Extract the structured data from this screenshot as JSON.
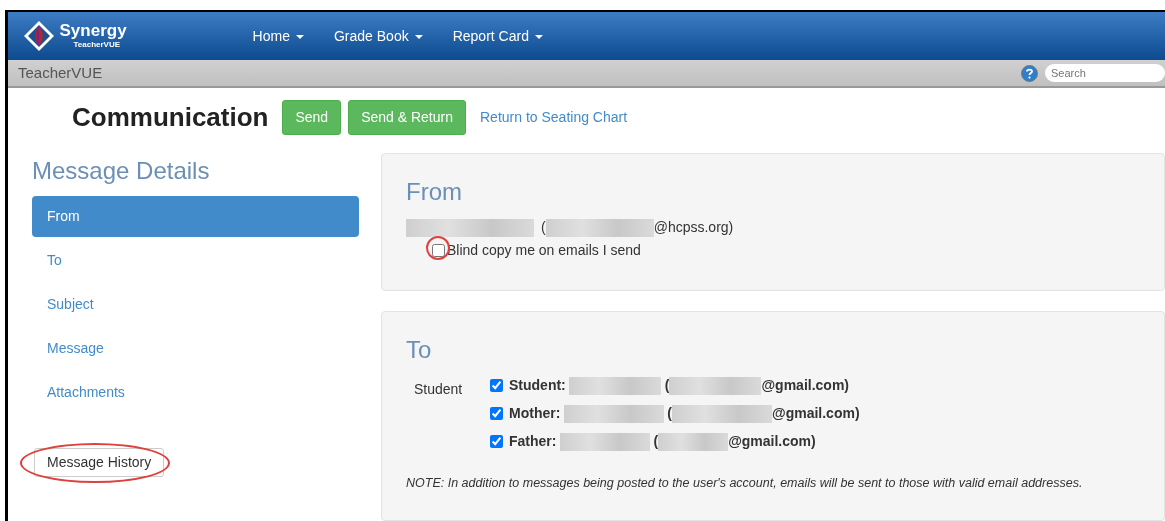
{
  "brand": {
    "name": "Synergy",
    "sub": "TeacherVUE"
  },
  "menu": [
    {
      "label": "Home"
    },
    {
      "label": "Grade Book"
    },
    {
      "label": "Report Card"
    }
  ],
  "subbar": {
    "title": "TeacherVUE",
    "search": {
      "placeholder": "Search"
    }
  },
  "page": {
    "title": "Communication",
    "buttons": [
      "Send",
      "Send & Return"
    ],
    "link": "Return to Seating Chart"
  },
  "sidebar": {
    "title": "Message Details",
    "items": [
      {
        "label": "From",
        "selected": true
      },
      {
        "label": "To",
        "selected": false
      },
      {
        "label": "Subject",
        "selected": false
      },
      {
        "label": "Message",
        "selected": false
      },
      {
        "label": "Attachments",
        "selected": false
      }
    ],
    "history_button": "Message History"
  },
  "from": {
    "title": "From",
    "open_paren": "(",
    "email_suffix": "@hcpss.org)",
    "bcc": {
      "label": "Blind copy me on emails I send",
      "checked": false
    }
  },
  "to": {
    "title": "To",
    "group": "Student",
    "recipients": [
      {
        "label": "Student:",
        "open_paren": "(",
        "email_suffix": "@gmail.com)",
        "checked": true
      },
      {
        "label": "Mother:",
        "open_paren": "(",
        "email_suffix": "@gmail.com)",
        "checked": true
      },
      {
        "label": "Father:",
        "open_paren": "(",
        "email_suffix": "@gmail.com)",
        "checked": true
      }
    ],
    "note": "NOTE: In addition to messages being posted to the user's account, emails will be sent to those with valid email addresses."
  }
}
